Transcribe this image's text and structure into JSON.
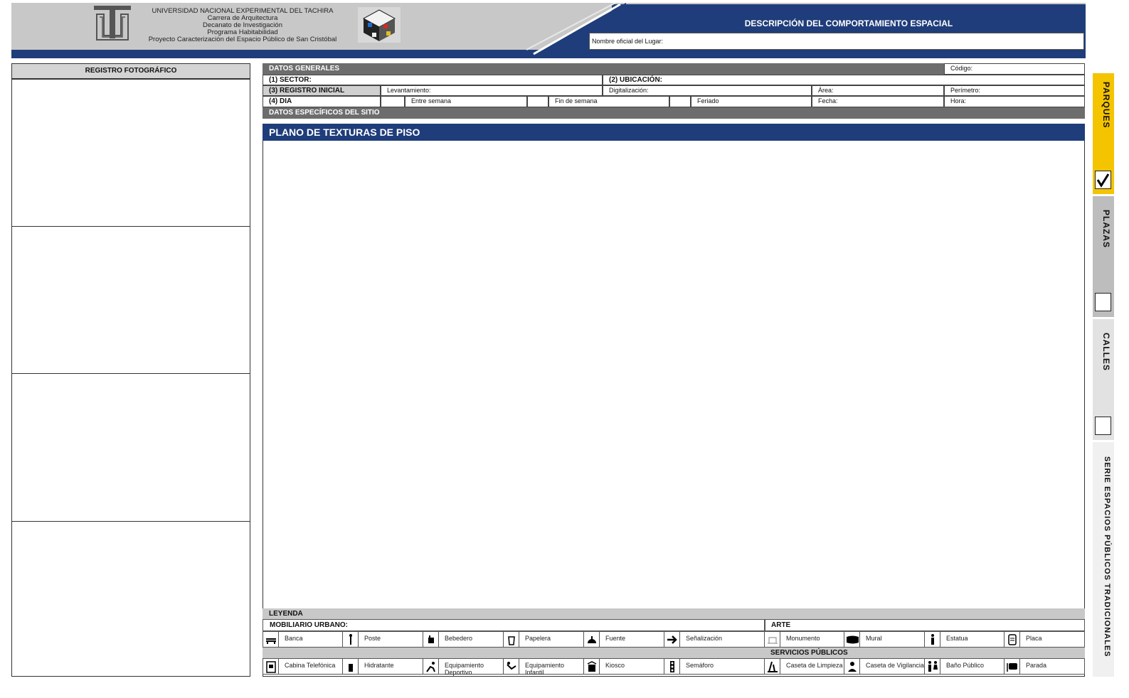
{
  "header": {
    "university_lines": [
      "UNIVERSIDAD NACIONAL EXPERIMENTAL DEL TACHIRA",
      "Carrera de Arquitectura",
      "Decanato de Investigación",
      "Programa Habitabilidad",
      "Proyecto Caracterización del Espacio Público de San Cristóbal"
    ],
    "title": "DESCRIPCIÓN  DEL COMPORTAMIENTO ESPACIAL",
    "lugar_label": "Nombre oficial del Lugar:"
  },
  "left": {
    "heading": "REGISTRO FOTOGRÁFICO"
  },
  "datos": {
    "generales": "DATOS GENERALES",
    "codigo": "Código:",
    "sector": "(1) SECTOR:",
    "ubicacion": "(2) UBICACIÓN:",
    "registro": "(3) REGISTRO INICIAL",
    "levantamiento": "Levantamiento:",
    "digitalizacion": "Digitalización:",
    "area": "Área:",
    "perimetro": "Perímetro:",
    "dia": "(4) DIA",
    "entre_semana": "Entre semana",
    "fin_semana": "Fin de semana",
    "feriado": "Feriado",
    "fecha": "Fecha:",
    "hora": "Hora:",
    "especificos": "DATOS ESPECÍFICOS DEL SITIO"
  },
  "plano": {
    "title": "PLANO DE TEXTURAS DE PISO"
  },
  "legend": {
    "title": "LEYENDA",
    "mobiliario": "MOBILIARIO URBANO:",
    "arte": "ARTE",
    "servicios": "SERVICIOS PÚBLICOS",
    "row1": [
      {
        "icon": "bench-icon",
        "label": "Banca"
      },
      {
        "icon": "pole-icon",
        "label": "Poste"
      },
      {
        "icon": "fountain-drink-icon",
        "label": "Bebedero"
      },
      {
        "icon": "trash-can-icon",
        "label": "Papelera"
      },
      {
        "icon": "fountain-icon",
        "label": "Fuente"
      },
      {
        "icon": "arrow-right-icon",
        "label": "Señalización"
      },
      {
        "icon": "monument-icon",
        "label": "Monumento"
      },
      {
        "icon": "mural-icon",
        "label": "Mural"
      },
      {
        "icon": "statue-icon",
        "label": "Estatua"
      },
      {
        "icon": "plaque-icon",
        "label": "Placa"
      }
    ],
    "row2": [
      {
        "icon": "phone-booth-icon",
        "label": "Cabina Telefónica"
      },
      {
        "icon": "hydrant-icon",
        "label": "Hidratante"
      },
      {
        "icon": "sports-icon",
        "label": "Equipamiento Deportivo"
      },
      {
        "icon": "playground-icon",
        "label": "Equipamiento Infantil"
      },
      {
        "icon": "kiosk-icon",
        "label": "Kiosco"
      },
      {
        "icon": "traffic-light-icon",
        "label": "Semáforo"
      },
      {
        "icon": "cleaning-icon",
        "label": "Caseta de Limpieza"
      },
      {
        "icon": "guard-icon",
        "label": "Caseta de Vigilancia"
      },
      {
        "icon": "restroom-icon",
        "label": "Baño Público"
      },
      {
        "icon": "bus-stop-icon",
        "label": "Parada"
      }
    ]
  },
  "side_tabs": {
    "parques": "PARQUES",
    "plazas": "PLAZAS",
    "calles": "CALLES",
    "serie": "SERIE ESPACIOS PÚBLICOS TRADICIONALES"
  },
  "colors": {
    "navy": "#1f3d7a",
    "gray_bar": "#6d6d6d",
    "yellow_tab": "#f5c400"
  }
}
